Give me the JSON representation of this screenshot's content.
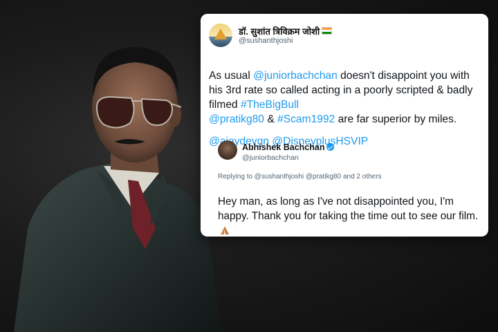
{
  "tweet": {
    "author_name": "डॉ. सुशांत त्रिविक्रम जोशी",
    "author_handle": "@sushanthjoshi",
    "line1_pre": "As usual ",
    "line1_mention": "@juniorbachchan",
    "line1_post": " doesn't disappoint you with",
    "line2": "his 3rd rate so called acting in a poorly scripted & badly",
    "line3_pre": "filmed ",
    "line3_hashtag": "#TheBigBull",
    "line4_mention": "@pratikg80",
    "line4_mid": " & ",
    "line4_hashtag": "#Scam1992",
    "line4_post": " are far superior by miles.",
    "line5_mention1": "@ajaydevgn",
    "line5_mention2": "@DisneyplusHSVIP"
  },
  "reply": {
    "author_name": "Abhishek Bachchan",
    "author_handle": "@juniorbachchan",
    "replying_to": "Replying to @sushanthjoshi @pratikg80 and 2 others",
    "text": "Hey man, as long as I've not disappointed you, I'm happy. Thank you for taking the time out to see our film."
  },
  "icons": {
    "avatar": "temple-avatar-icon",
    "flag": "india-flag-icon",
    "verified": "verified-badge-icon",
    "emoji": "folded-hands-icon"
  },
  "colors": {
    "link": "#1d9bf0",
    "text": "#0f1419",
    "muted": "#536471"
  }
}
